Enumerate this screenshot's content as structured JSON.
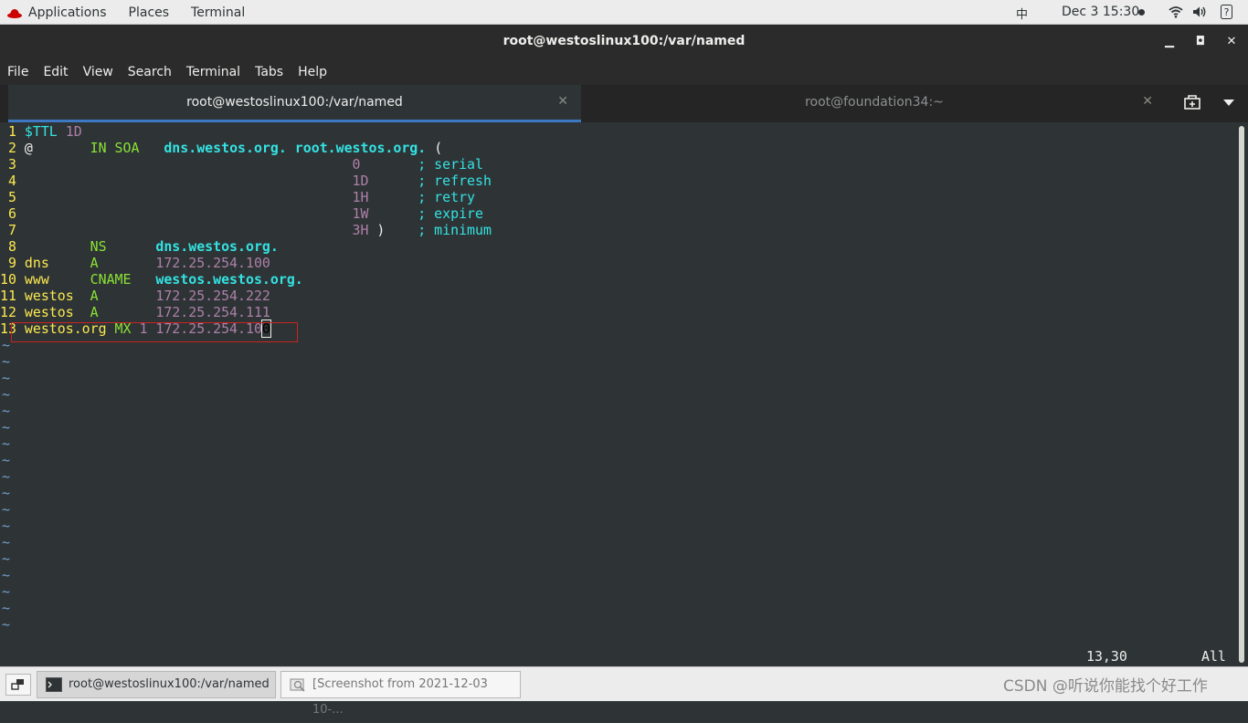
{
  "topbar": {
    "applications": "Applications",
    "places": "Places",
    "terminal": "Terminal",
    "ime": "中",
    "clock": "Dec 3  15:30"
  },
  "window": {
    "title": "root@westoslinux100:/var/named",
    "menu": [
      "File",
      "Edit",
      "View",
      "Search",
      "Terminal",
      "Tabs",
      "Help"
    ]
  },
  "tabs": [
    {
      "label": "root@westoslinux100:/var/named",
      "active": true
    },
    {
      "label": "root@foundation34:~",
      "active": false
    }
  ],
  "editor": {
    "lines": [
      {
        "no": " 1",
        "parts": [
          [
            "var",
            "$TTL"
          ],
          [
            "def",
            " "
          ],
          [
            "num",
            "1D"
          ]
        ]
      },
      {
        "no": " 2",
        "parts": [
          [
            "def",
            "@       "
          ],
          [
            "kw",
            "IN SOA"
          ],
          [
            "def",
            "   "
          ],
          [
            "fqdn",
            "dns.westos.org."
          ],
          [
            "def",
            " "
          ],
          [
            "fqdn",
            "root.westos.org."
          ],
          [
            "def",
            " ("
          ]
        ]
      },
      {
        "no": " 3",
        "parts": [
          [
            "def",
            "                                        "
          ],
          [
            "num",
            "0"
          ],
          [
            "def",
            "       "
          ],
          [
            "cmt",
            "; serial"
          ]
        ]
      },
      {
        "no": " 4",
        "parts": [
          [
            "def",
            "                                        "
          ],
          [
            "num",
            "1D"
          ],
          [
            "def",
            "      "
          ],
          [
            "cmt",
            "; refresh"
          ]
        ]
      },
      {
        "no": " 5",
        "parts": [
          [
            "def",
            "                                        "
          ],
          [
            "num",
            "1H"
          ],
          [
            "def",
            "      "
          ],
          [
            "cmt",
            "; retry"
          ]
        ]
      },
      {
        "no": " 6",
        "parts": [
          [
            "def",
            "                                        "
          ],
          [
            "num",
            "1W"
          ],
          [
            "def",
            "      "
          ],
          [
            "cmt",
            "; expire"
          ]
        ]
      },
      {
        "no": " 7",
        "parts": [
          [
            "def",
            "                                        "
          ],
          [
            "num",
            "3H"
          ],
          [
            "def",
            " )    "
          ],
          [
            "cmt",
            "; minimum"
          ]
        ]
      },
      {
        "no": " 8",
        "parts": [
          [
            "def",
            "        "
          ],
          [
            "kw",
            "NS"
          ],
          [
            "def",
            "      "
          ],
          [
            "fqdn",
            "dns.westos.org."
          ]
        ]
      },
      {
        "no": " 9",
        "parts": [
          [
            "rec",
            "dns"
          ],
          [
            "def",
            "     "
          ],
          [
            "kw",
            "A"
          ],
          [
            "def",
            "       "
          ],
          [
            "num",
            "172.25.254.100"
          ]
        ]
      },
      {
        "no": "10",
        "parts": [
          [
            "rec",
            "www"
          ],
          [
            "def",
            "     "
          ],
          [
            "kw",
            "CNAME"
          ],
          [
            "def",
            "   "
          ],
          [
            "fqdn",
            "westos.westos.org."
          ]
        ]
      },
      {
        "no": "11",
        "parts": [
          [
            "rec",
            "westos"
          ],
          [
            "def",
            "  "
          ],
          [
            "kw",
            "A"
          ],
          [
            "def",
            "       "
          ],
          [
            "num",
            "172.25.254.222"
          ]
        ]
      },
      {
        "no": "12",
        "parts": [
          [
            "rec",
            "westos"
          ],
          [
            "def",
            "  "
          ],
          [
            "kw",
            "A"
          ],
          [
            "def",
            "       "
          ],
          [
            "num",
            "172.25.254.111"
          ]
        ]
      },
      {
        "no": "13",
        "parts": [
          [
            "rec",
            "westos.org"
          ],
          [
            "def",
            " "
          ],
          [
            "kw",
            "MX"
          ],
          [
            "def",
            " "
          ],
          [
            "num",
            "1"
          ],
          [
            "def",
            " "
          ],
          [
            "num",
            "172.25.254.10"
          ],
          [
            "cursor",
            "0"
          ]
        ]
      }
    ],
    "empty_marker": "~",
    "position": "13,30",
    "scroll": "All"
  },
  "taskbar": {
    "active_task": "root@westoslinux100:/var/named",
    "inactive_task": "[Screenshot from 2021-12-03 10-..."
  },
  "watermark": "CSDN @听说你能找个好工作",
  "colors": {
    "terminal_bg": "#2e3436",
    "line_number": "#fce94f",
    "keyword": "#8ae234",
    "number": "#ad7fa8",
    "identifier": "#34e2e2",
    "tilde": "#729fcf",
    "highlight_box": "#cc2222",
    "active_tab_underline": "#3c78c3"
  }
}
